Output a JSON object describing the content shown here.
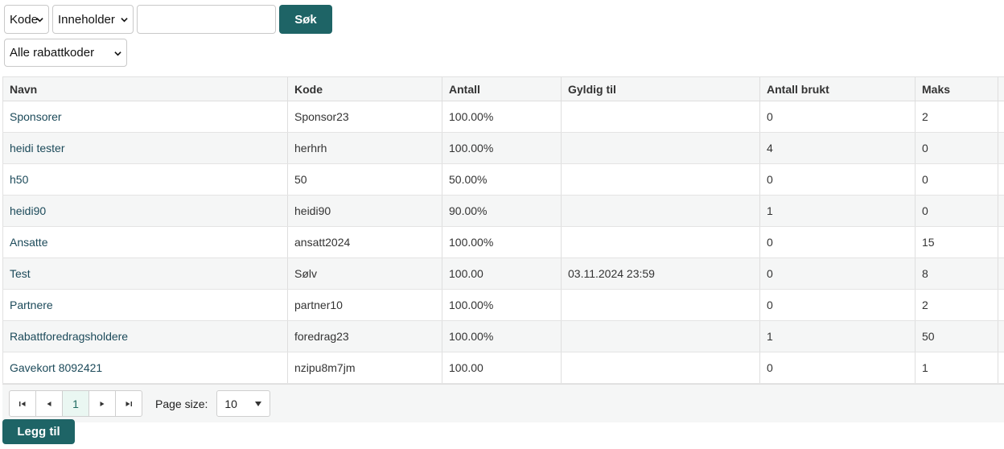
{
  "filters": {
    "field_select": "Kode",
    "match_select": "Inneholder",
    "search_value": "",
    "search_button": "Søk",
    "discount_select": "Alle rabattkoder"
  },
  "table": {
    "columns": [
      "Navn",
      "Kode",
      "Antall",
      "Gyldig til",
      "Antall brukt",
      "Maks"
    ],
    "rows": [
      {
        "navn": "Sponsorer",
        "kode": "Sponsor23",
        "antall": "100.00%",
        "gyldig": "",
        "brukt": "0",
        "maks": "2"
      },
      {
        "navn": "heidi tester",
        "kode": "herhrh",
        "antall": "100.00%",
        "gyldig": "",
        "brukt": "4",
        "maks": "0"
      },
      {
        "navn": "h50",
        "kode": "50",
        "antall": "50.00%",
        "gyldig": "",
        "brukt": "0",
        "maks": "0"
      },
      {
        "navn": "heidi90",
        "kode": "heidi90",
        "antall": "90.00%",
        "gyldig": "",
        "brukt": "1",
        "maks": "0"
      },
      {
        "navn": "Ansatte",
        "kode": "ansatt2024",
        "antall": "100.00%",
        "gyldig": "",
        "brukt": "0",
        "maks": "15"
      },
      {
        "navn": "Test",
        "kode": "Sølv",
        "antall": "100.00",
        "gyldig": "03.11.2024 23:59",
        "brukt": "0",
        "maks": "8"
      },
      {
        "navn": "Partnere",
        "kode": "partner10",
        "antall": "100.00%",
        "gyldig": "",
        "brukt": "0",
        "maks": "2"
      },
      {
        "navn": "Rabattforedragsholdere",
        "kode": "foredrag23",
        "antall": "100.00%",
        "gyldig": "",
        "brukt": "1",
        "maks": "50"
      },
      {
        "navn": "Gavekort 8092421",
        "kode": "nzipu8m7jm",
        "antall": "100.00",
        "gyldig": "",
        "brukt": "0",
        "maks": "1"
      }
    ]
  },
  "pager": {
    "current_page": "1",
    "page_size_label": "Page size:",
    "page_size_value": "10",
    "icons": [
      "first-page-icon",
      "prev-page-icon",
      "next-page-icon",
      "last-page-icon"
    ]
  },
  "actions": {
    "add_button": "Legg til"
  },
  "colors": {
    "primary": "#1e6466",
    "link": "#1c4a5a",
    "row_alt": "#f5f6f6"
  }
}
